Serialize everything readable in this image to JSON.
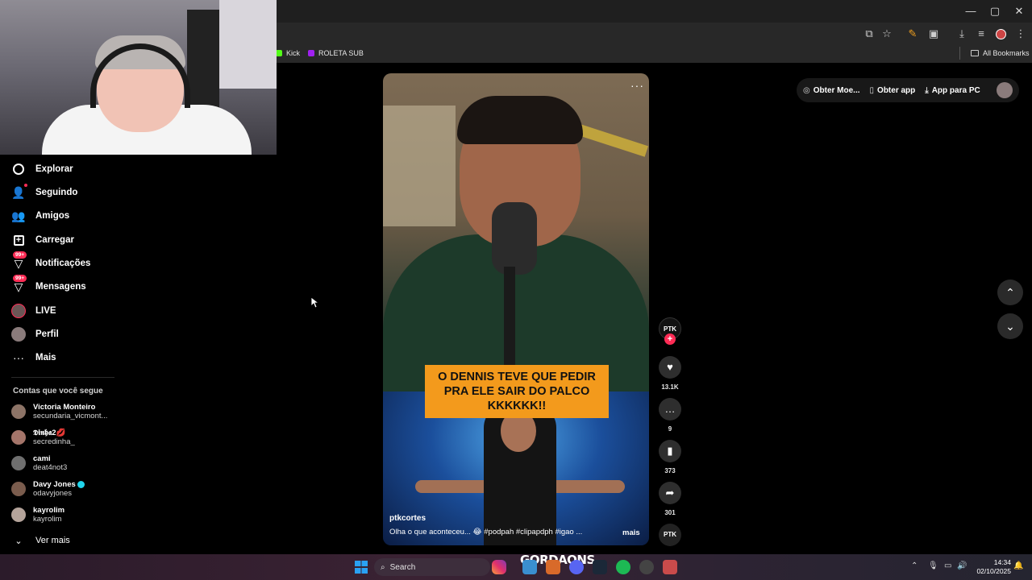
{
  "window": {
    "minimize": "—",
    "maximize": "▢",
    "close": "✕"
  },
  "toolbar": {
    "icons": [
      "cast-icon",
      "star-icon",
      "extension-icon",
      "puzzle-icon",
      "download-icon",
      "media-icon",
      "profile-icon",
      "menu-icon"
    ]
  },
  "bookmarks": [
    {
      "label": "Kick",
      "color": "#53fc18"
    },
    {
      "label": "ROLETA SUB",
      "color": "#a020f0"
    }
  ],
  "all_bookmarks": "All Bookmarks",
  "nav": [
    {
      "label": "Explorar",
      "icon": "compass-icon"
    },
    {
      "label": "Seguindo",
      "icon": "user-follow-icon"
    },
    {
      "label": "Amigos",
      "icon": "friends-icon"
    },
    {
      "label": "Carregar",
      "icon": "upload-icon"
    },
    {
      "label": "Notificações",
      "icon": "bell-icon",
      "badge": "99+"
    },
    {
      "label": "Mensagens",
      "icon": "message-icon",
      "badge": "99+"
    },
    {
      "label": "LIVE",
      "icon": "live-icon"
    },
    {
      "label": "Perfil",
      "icon": "avatar-icon"
    },
    {
      "label": "Mais",
      "icon": "more-icon"
    }
  ],
  "following": {
    "title": "Contas que você segue",
    "accounts": [
      {
        "name": "Victoria Monteiro",
        "handle": "secundaria_vicmont..."
      },
      {
        "name": "𝕯𝖎𝖓𝖍𝖆2💋",
        "handle": "secredinha_"
      },
      {
        "name": "cami",
        "handle": "deat4not3"
      },
      {
        "name": "Davy Jones",
        "handle": "odavyjones",
        "verified": true
      },
      {
        "name": "kayrolim",
        "handle": "kayrolim"
      }
    ],
    "see_more": "Ver mais"
  },
  "video": {
    "caption": "O DENNIS TEVE QUE PEDIR PRA ELE SAIR DO PALCO KKKKKK!!",
    "username": "ptkcortes",
    "description": "Olha o que aconteceu... 😂 #podpah #clipapdph #igao ...",
    "more": "mais",
    "author_badge": "PTK",
    "likes": "13.1K",
    "comments": "9",
    "saves": "373",
    "shares": "301"
  },
  "header_pill": {
    "coins": "Obter Moe...",
    "app": "Obter app",
    "pc": "App para PC"
  },
  "taskbar": {
    "search": "Search",
    "overlay_text": "GORDAONS",
    "time": "14:34",
    "date": "02/10/2025"
  },
  "colors": {
    "accent": "#fe2c55",
    "caption_bg": "#f39a1c",
    "verified": "#20d5ec"
  }
}
